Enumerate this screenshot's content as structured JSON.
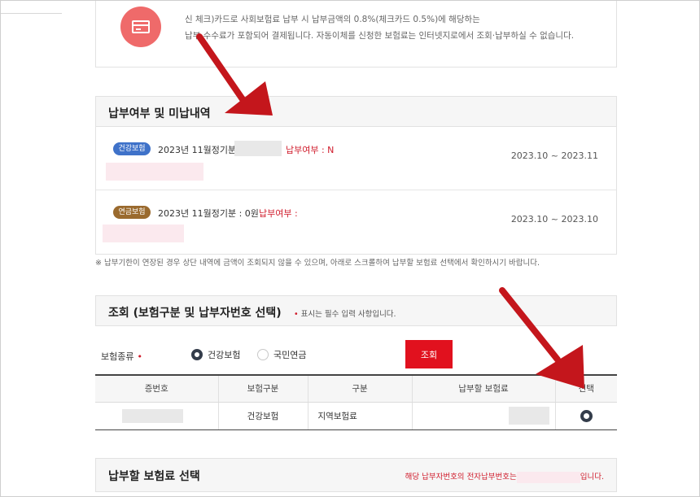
{
  "card_info": {
    "icon": "credit-card-icon",
    "line1": "신 체크)카드로 사회보험료 납부 시 납부금액의 0.8%(체크카드 0.5%)에 해당하는",
    "line2": "납부 수수료가 포함되어 결제됩니다. 자동이체를 신청한 보험료는 인터넷지로에서 조회·납부하실 수 없습니다."
  },
  "payment_status": {
    "title": "납부여부 및 미납내역",
    "rows": [
      {
        "badge": "건강보험",
        "badge_color": "#3f72c9",
        "text": "2023년 11월정기분 :",
        "status": "납부여부 : N",
        "period": "2023.10 ~ 2023.11"
      },
      {
        "badge": "연금보험",
        "badge_color": "#9a6a2e",
        "text": "2023년 11월정기분 : 0원",
        "status": "납부여부 :",
        "period": "2023.10 ~ 2023.10"
      }
    ],
    "note": "※ 납부기한이 연장된 경우 상단 내역에 금액이 조회되지 않을 수 있으며, 아래로 스크롤하여 납부할 보험료 선택에서 확인하시기 바랍니다."
  },
  "search": {
    "title": "조회 (보험구분 및 납부자번호 선택)",
    "required_dot": "•",
    "required_note": "표시는 필수 입력 사항입니다.",
    "insurance_label": "보험종류",
    "required_mark": "•",
    "options": [
      {
        "label": "건강보험",
        "selected": true
      },
      {
        "label": "국민연금",
        "selected": false
      }
    ],
    "button_label": "조회"
  },
  "table": {
    "headers": [
      "증번호",
      "보험구분",
      "구분",
      "납부할 보험료",
      "선택"
    ],
    "rows": [
      {
        "insurance_type": "건강보험",
        "category": "지역보험료",
        "selected": true
      }
    ]
  },
  "select_section": {
    "title": "납부할 보험료 선택",
    "note_prefix": "해당 납부자번호의 전자납부번호는",
    "note_suffix": "입니다."
  },
  "annotation_color": "#c4161c"
}
